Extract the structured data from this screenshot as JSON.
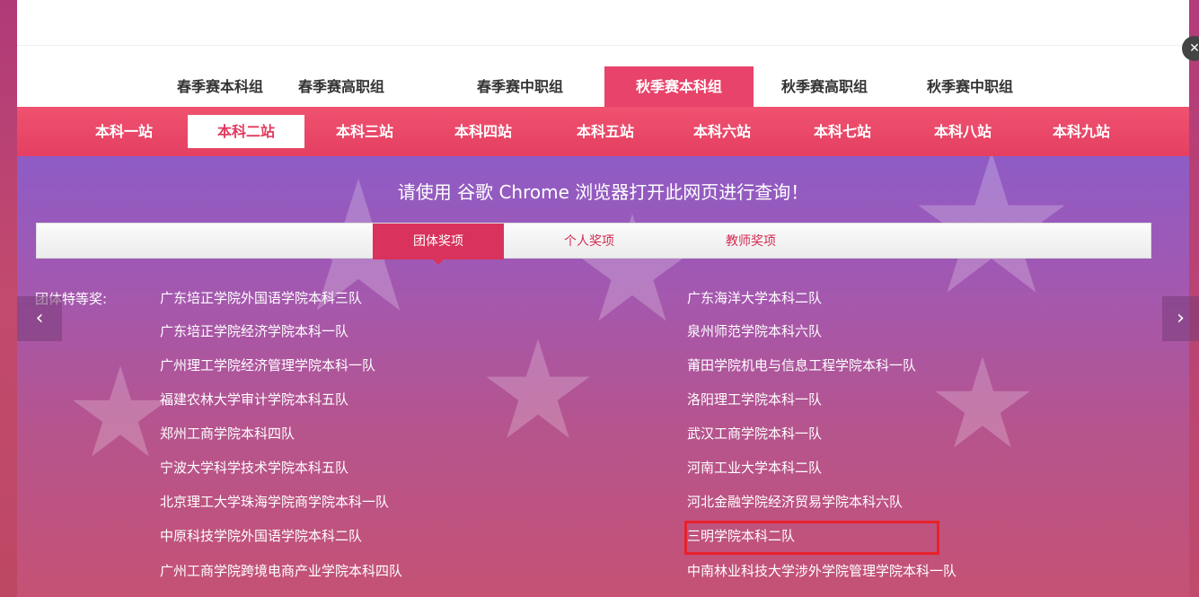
{
  "season_tabs": [
    {
      "label": "春季赛本科组",
      "active": false
    },
    {
      "label": "春季赛高职组",
      "active": false
    },
    {
      "label": "春季赛中职组",
      "active": false
    },
    {
      "label": "秋季赛本科组",
      "active": true
    },
    {
      "label": "秋季赛高职组",
      "active": false
    },
    {
      "label": "秋季赛中职组",
      "active": false
    }
  ],
  "station_tabs": [
    {
      "label": "本科一站",
      "active": false
    },
    {
      "label": "本科二站",
      "active": true
    },
    {
      "label": "本科三站",
      "active": false
    },
    {
      "label": "本科四站",
      "active": false
    },
    {
      "label": "本科五站",
      "active": false
    },
    {
      "label": "本科六站",
      "active": false
    },
    {
      "label": "本科七站",
      "active": false
    },
    {
      "label": "本科八站",
      "active": false
    },
    {
      "label": "本科九站",
      "active": false
    }
  ],
  "notice": "请使用 谷歌 Chrome 浏览器打开此网页进行查询！",
  "award_tabs": [
    {
      "label": "团体奖项",
      "active": true
    },
    {
      "label": "个人奖项",
      "active": false
    },
    {
      "label": "教师奖项",
      "active": false
    }
  ],
  "category_label": "团体特等奖:",
  "teams_left": [
    "广东培正学院外国语学院本科三队",
    "广东培正学院经济学院本科一队",
    "广州理工学院经济管理学院本科一队",
    "福建农林大学审计学院本科五队",
    "郑州工商学院本科四队",
    "宁波大学科学技术学院本科五队",
    "北京理工大学珠海学院商学院本科一队",
    "中原科技学院外国语学院本科二队",
    "广州工商学院跨境电商产业学院本科四队"
  ],
  "teams_right": [
    "广东海洋大学本科二队",
    "泉州师范学院本科六队",
    "莆田学院机电与信息工程学院本科一队",
    "洛阳理工学院本科一队",
    "武汉工商学院本科一队",
    "河南工业大学本科二队",
    "河北金融学院经济贸易学院本科六队",
    "三明学院本科二队",
    "中南林业科技大学涉外学院管理学院本科一队"
  ],
  "highlighted_team": "三明学院本科二队",
  "nav": {
    "prev_icon": "‹",
    "next_icon": "›"
  },
  "colors": {
    "accent": "#e8436a",
    "highlight_border": "#e8202a"
  }
}
